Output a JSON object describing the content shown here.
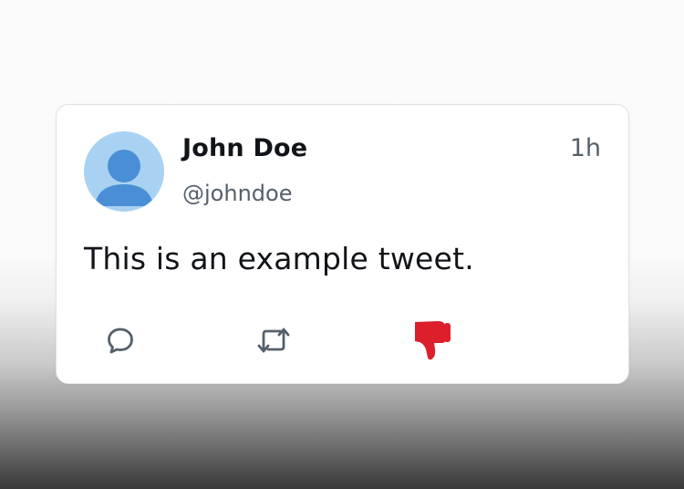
{
  "tweet": {
    "display_name": "John Doe",
    "handle": "@johndoe",
    "time": "1h",
    "text": "This is an example tweet."
  },
  "actions": {
    "reply_icon": "speech-bubble-icon",
    "retweet_icon": "retweet-arrows-icon",
    "dislike_icon": "thumbs-down-icon"
  },
  "colors": {
    "avatar_bg": "#a9d2f2",
    "avatar_figure": "#4a8fd6",
    "icon_gray": "#55606b",
    "dislike_red": "#dd1f2c"
  }
}
